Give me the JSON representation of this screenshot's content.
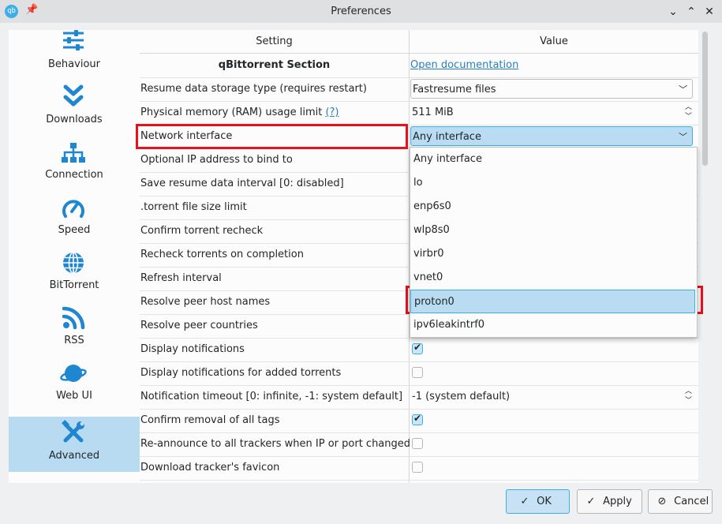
{
  "window": {
    "title": "Preferences",
    "app_icon": "qbittorrent-logo-icon",
    "pin_glyph": "📌"
  },
  "titlebar_buttons": {
    "minimize": "⌄",
    "maximize": "⌃",
    "close": "✕"
  },
  "sidebar": {
    "items": [
      {
        "label": "Behaviour",
        "icon": "sliders-icon"
      },
      {
        "label": "Downloads",
        "icon": "double-chevron-down-icon"
      },
      {
        "label": "Connection",
        "icon": "network-icon"
      },
      {
        "label": "Speed",
        "icon": "speedometer-icon"
      },
      {
        "label": "BitTorrent",
        "icon": "globe-icon"
      },
      {
        "label": "RSS",
        "icon": "rss-icon"
      },
      {
        "label": "Web UI",
        "icon": "planet-icon"
      },
      {
        "label": "Advanced",
        "icon": "wrench-screwdriver-icon"
      }
    ]
  },
  "table": {
    "headers": {
      "setting": "Setting",
      "value": "Value"
    },
    "section": {
      "title": "qBittorrent Section",
      "link": "Open documentation"
    },
    "rows": [
      {
        "setting": "Resume data storage type (requires restart)",
        "value": "Fastresume files"
      },
      {
        "setting": "Physical memory (RAM) usage limit",
        "help": "(?)",
        "value": "511 MiB"
      },
      {
        "setting": "Network interface",
        "value": "Any interface"
      },
      {
        "setting": "Optional IP address to bind to"
      },
      {
        "setting": "Save resume data interval [0: disabled]"
      },
      {
        "setting": ".torrent file size limit"
      },
      {
        "setting": "Confirm torrent recheck"
      },
      {
        "setting": "Recheck torrents on completion"
      },
      {
        "setting": "Refresh interval"
      },
      {
        "setting": "Resolve peer host names"
      },
      {
        "setting": "Resolve peer countries"
      },
      {
        "setting": "Display notifications",
        "checked": true
      },
      {
        "setting": "Display notifications for added torrents",
        "checked": false
      },
      {
        "setting": "Notification timeout [0: infinite, -1: system default]",
        "value": "-1 (system default)"
      },
      {
        "setting": "Confirm removal of all tags",
        "checked": true
      },
      {
        "setting": "Re-announce to all trackers when IP or port changed",
        "checked": false
      },
      {
        "setting": "Download tracker's favicon",
        "checked": false
      }
    ]
  },
  "dropdown": {
    "options": [
      "Any interface",
      "lo",
      "enp6s0",
      "wlp8s0",
      "virbr0",
      "vnet0",
      "proton0",
      "ipv6leakintrf0"
    ],
    "selected": "proton0"
  },
  "buttons": {
    "ok": "OK",
    "apply": "Apply",
    "cancel": "Cancel"
  },
  "colors": {
    "accent": "#3daee9",
    "highlight": "#e8101a",
    "selection": "#b9dcf2"
  }
}
